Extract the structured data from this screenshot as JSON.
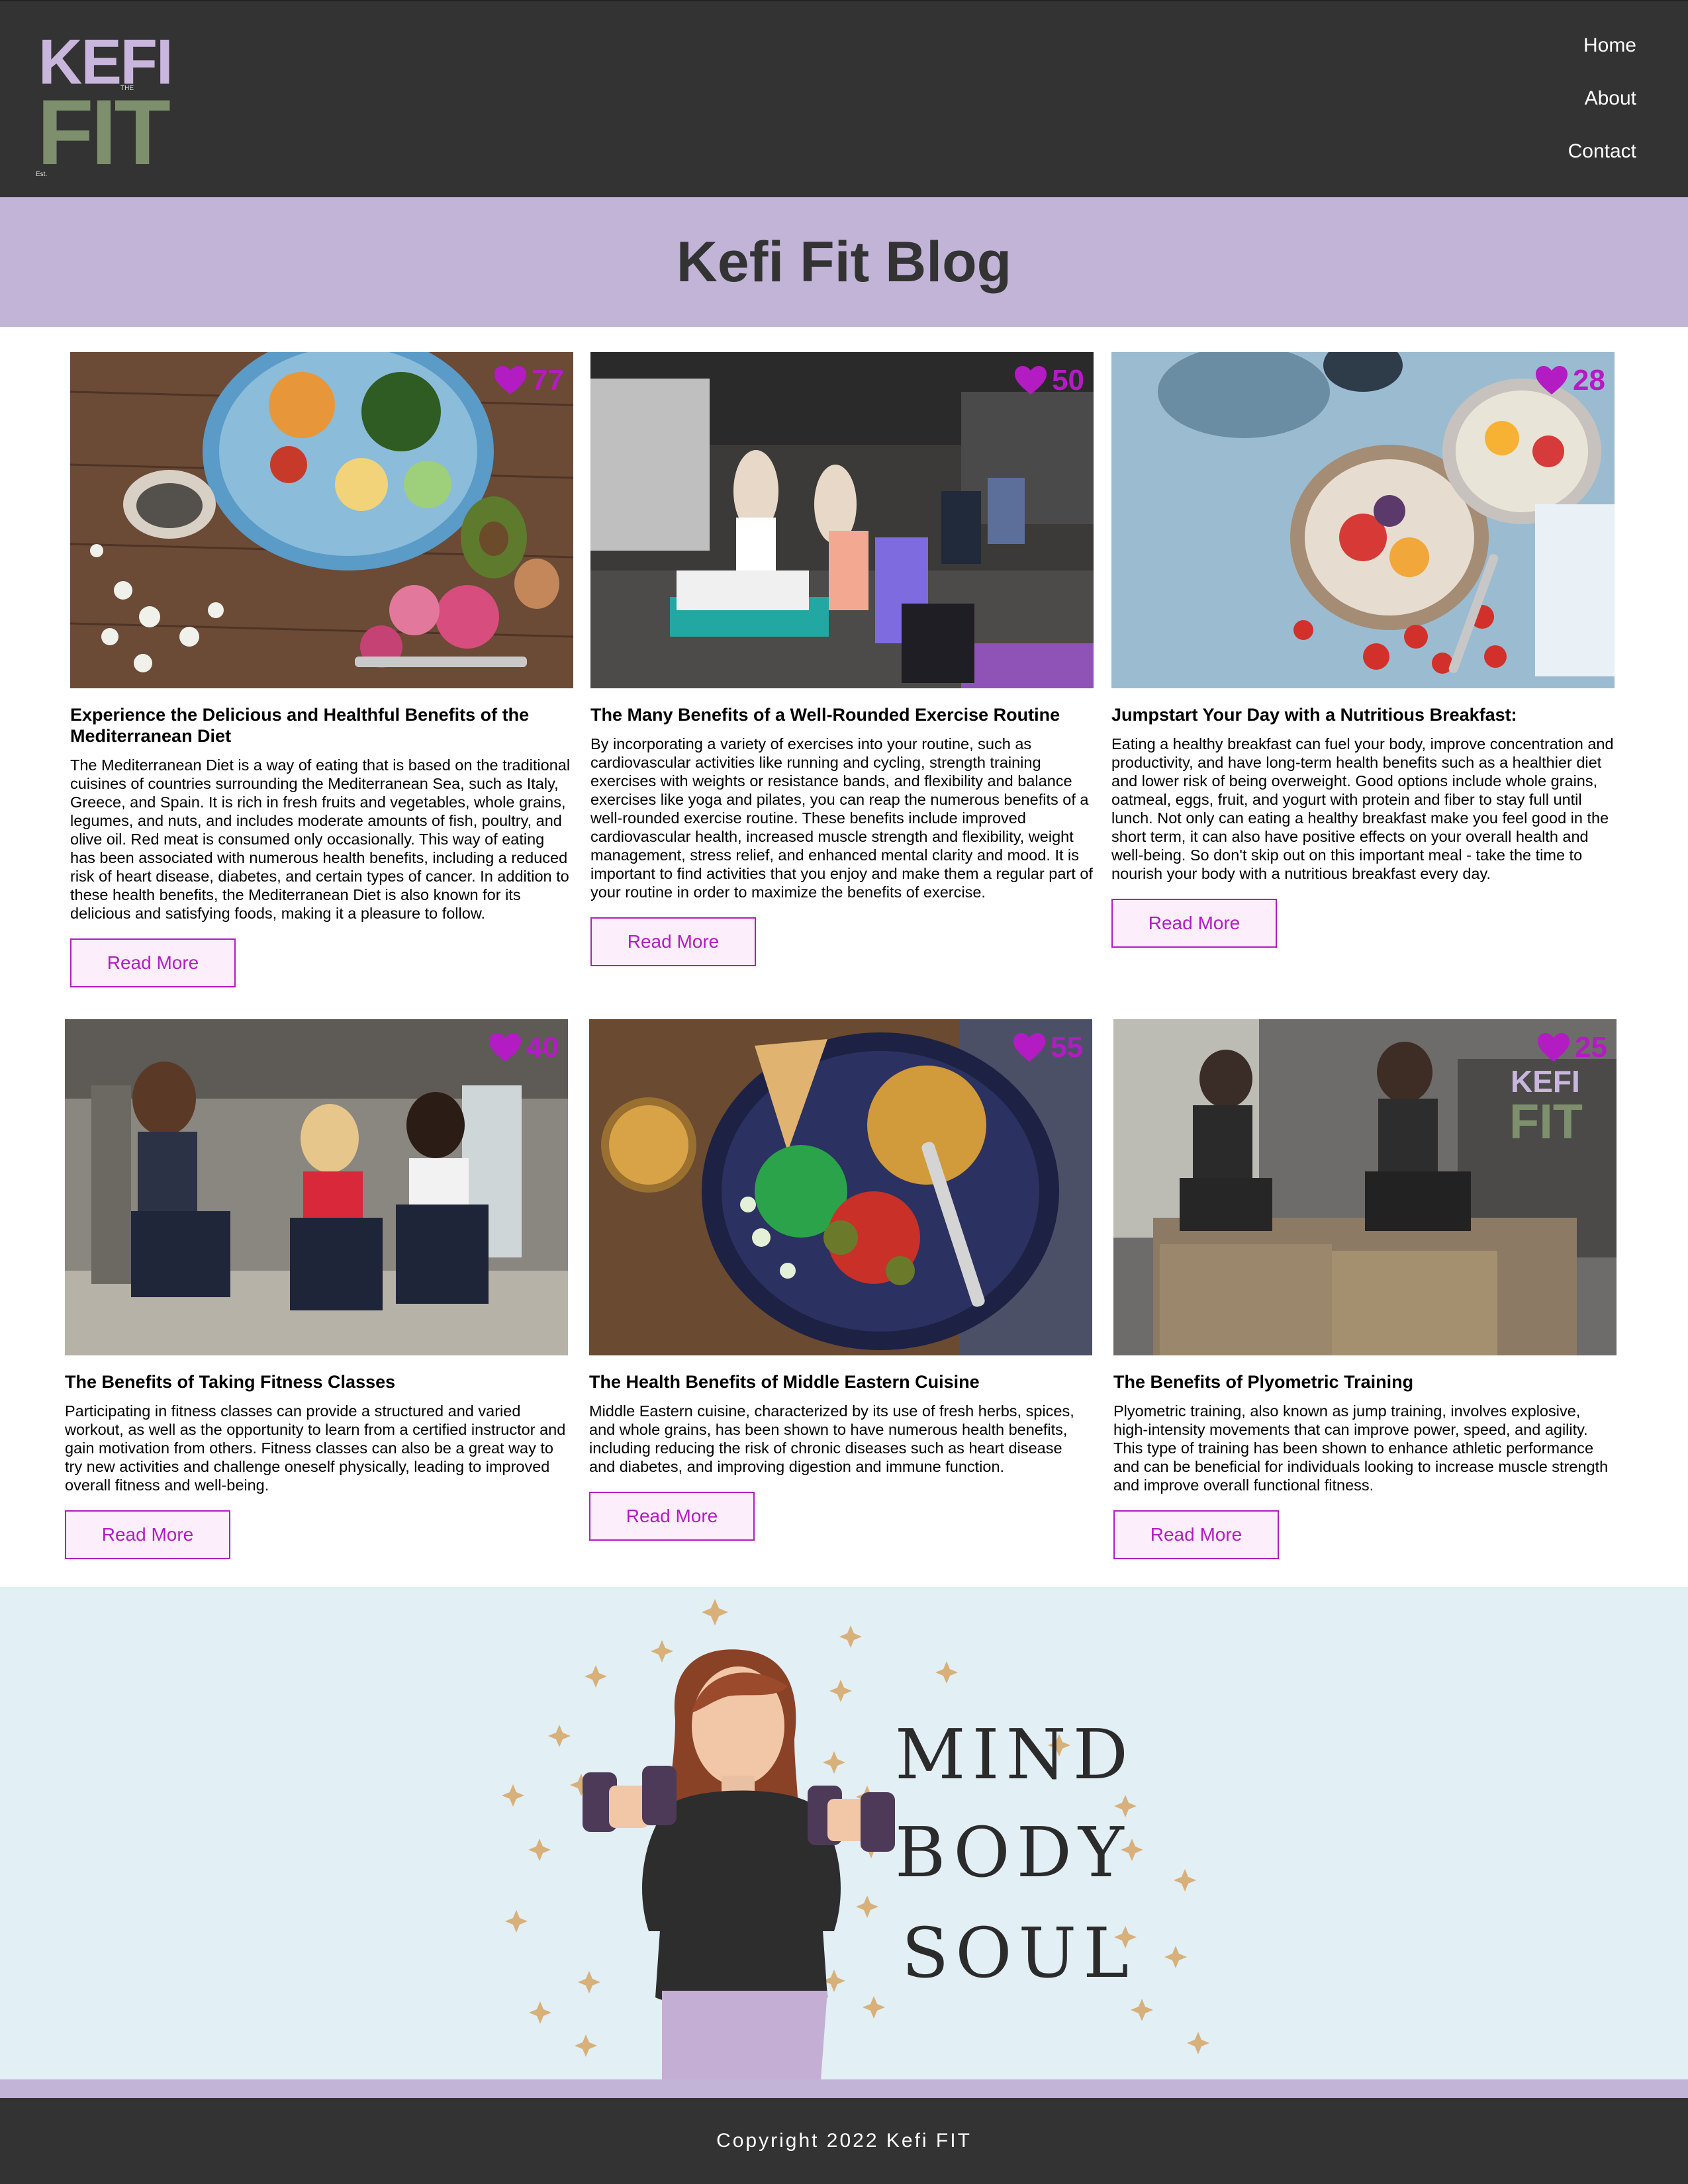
{
  "brand": {
    "logo_top": "KEFI",
    "logo_bottom": "FIT",
    "logo_tag": "THE",
    "logo_small": "Est."
  },
  "nav": {
    "items": [
      {
        "label": "Home"
      },
      {
        "label": "About"
      },
      {
        "label": "Contact"
      }
    ]
  },
  "page_title": "Kefi Fit Blog",
  "posts": [
    {
      "likes": "77",
      "title": "Experience the Delicious and Healthful Benefits of the Mediterranean Diet",
      "body": "The Mediterranean Diet is a way of eating that is based on the traditional cuisines of countries surrounding the Mediterranean Sea, such as Italy, Greece, and Spain. It is rich in fresh fruits and vegetables, whole grains, legumes, and nuts, and includes moderate amounts of fish, poultry, and olive oil. Red meat is consumed only occasionally. This way of eating has been associated with numerous health benefits, including a reduced risk of heart disease, diabetes, and certain types of cancer. In addition to these health benefits, the Mediterranean Diet is also known for its delicious and satisfying foods, making it a pleasure to follow.",
      "button": "Read More",
      "image": "mediterranean-salad-plate"
    },
    {
      "likes": "50",
      "title": "The Many Benefits of a Well-Rounded Exercise Routine",
      "body": "By incorporating a variety of exercises into your routine, such as cardiovascular activities like running and cycling, strength training exercises with weights or resistance bands, and flexibility and balance exercises like yoga and pilates, you can reap the numerous benefits of a well-rounded exercise routine. These benefits include improved cardiovascular health, increased muscle strength and flexibility, weight management, stress relief, and enhanced mental clarity and mood. It is important to find activities that you enjoy and make them a regular part of your routine in order to maximize the benefits of exercise.",
      "button": "Read More",
      "image": "yoga-class"
    },
    {
      "likes": "28",
      "title": "Jumpstart Your Day with a Nutritious Breakfast:",
      "body": "Eating a healthy breakfast can fuel your body, improve concentration and productivity, and have long-term health benefits such as a healthier diet and lower risk of being overweight. Good options include whole grains, oatmeal, eggs, fruit, and yogurt with protein and fiber to stay full until lunch. Not only can eating a healthy breakfast make you feel good in the short term, it can also have positive effects on your overall health and well-being. So don't skip out on this important meal - take the time to nourish your body with a nutritious breakfast every day.",
      "button": "Read More",
      "image": "breakfast-bowls"
    },
    {
      "likes": "40",
      "title": "The Benefits of Taking Fitness Classes",
      "body": "Participating in fitness classes can provide a structured and varied workout, as well as the opportunity to learn from a certified instructor and gain motivation from others. Fitness classes can also be a great way to try new activities and challenge oneself physically, leading to improved overall fitness and well-being.",
      "button": "Read More",
      "image": "women-fitness-class"
    },
    {
      "likes": "55",
      "title": "The Health Benefits of Middle Eastern Cuisine",
      "body": "Middle Eastern cuisine, characterized by its use of fresh herbs, spices, and whole grains, has been shown to have numerous health benefits, including reducing the risk of chronic diseases such as heart disease and diabetes, and improving digestion and immune function.",
      "button": "Read More",
      "image": "middle-eastern-bowl"
    },
    {
      "likes": "25",
      "title": "The Benefits of Plyometric Training",
      "body": "Plyometric training, also known as jump training, involves explosive, high-intensity movements that can improve power, speed, and agility. This type of training has been shown to enhance athletic performance and can be beneficial for individuals looking to increase muscle strength and improve overall functional fitness.",
      "button": "Read More",
      "image": "box-jump-training"
    }
  ],
  "hero": {
    "line1": "MIND",
    "line2": "BODY",
    "line3": "SOUL"
  },
  "footer": {
    "copyright": "Copyright 2022 Kefi FIT"
  },
  "colors": {
    "header_bg": "#333333",
    "title_band": "#c2b4d6",
    "accent": "#b21cc2",
    "button_bg": "#fdeefc",
    "hero_bg": "#e2eff5"
  }
}
